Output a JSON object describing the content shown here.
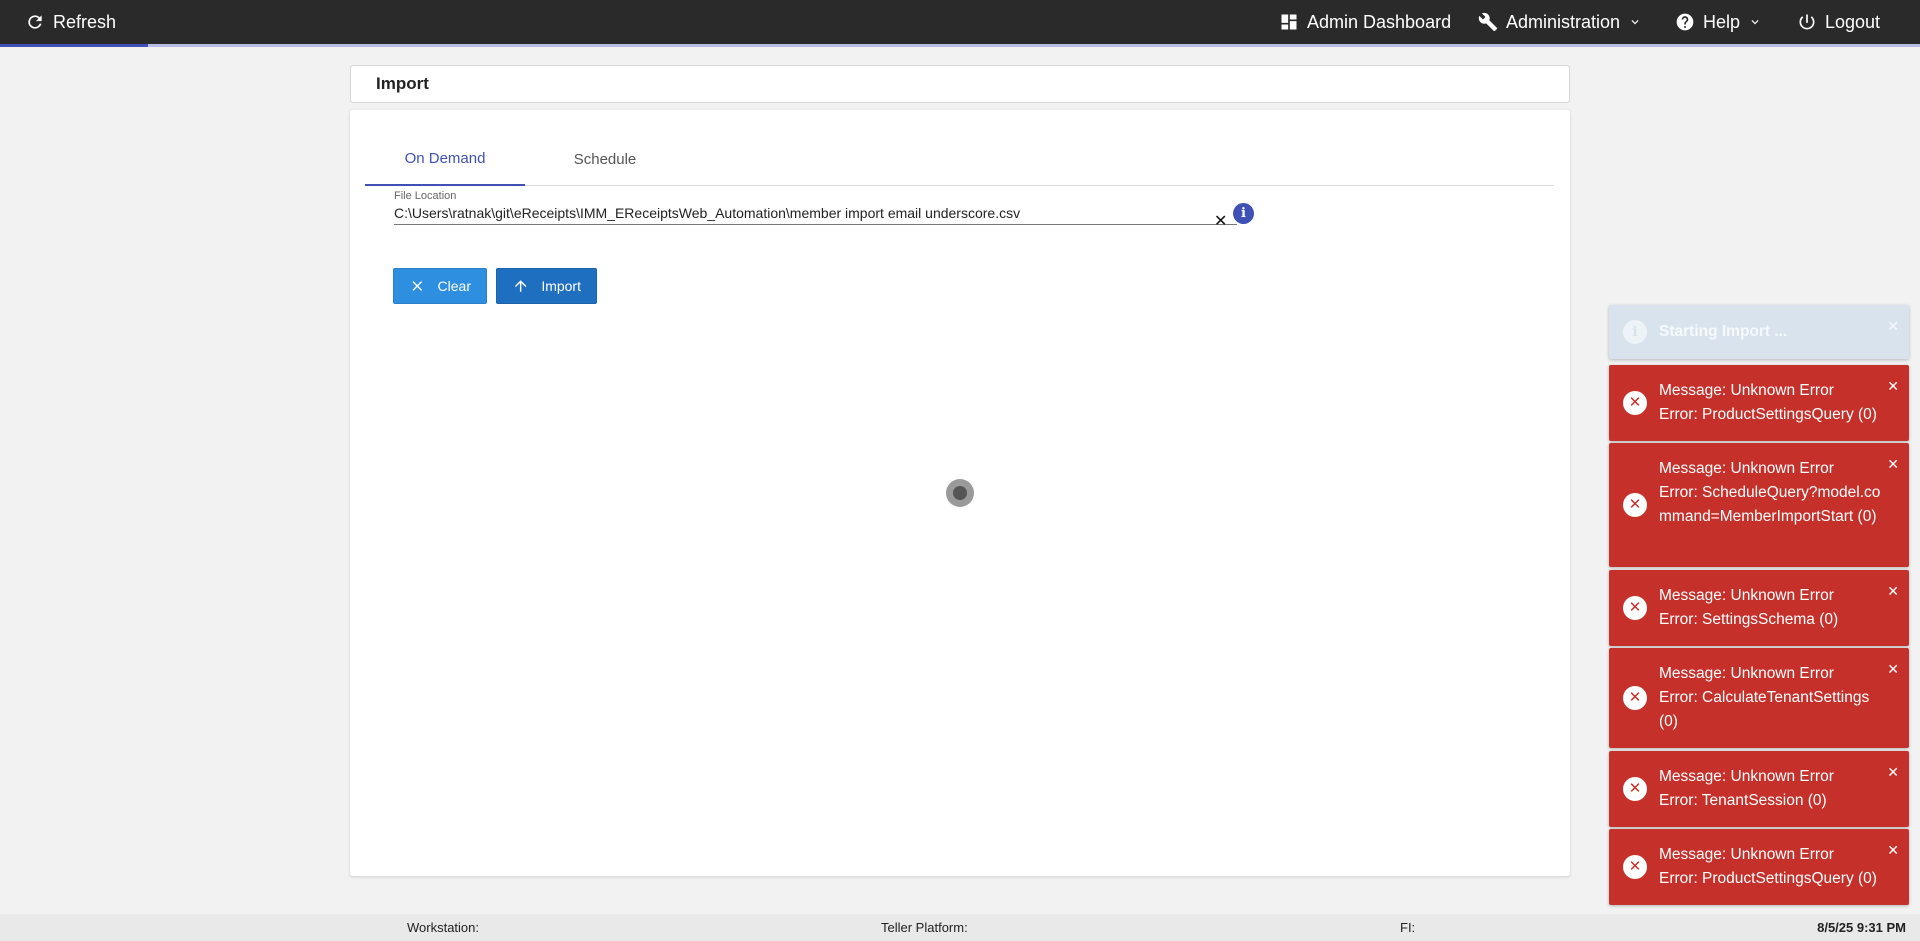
{
  "topbar": {
    "refresh_label": "Refresh",
    "admin_dashboard_label": "Admin Dashboard",
    "administration_label": "Administration",
    "help_label": "Help",
    "logout_label": "Logout",
    "progress_fraction": 0.077,
    "accent_color": "#3f51b5"
  },
  "page": {
    "title": "Import",
    "tabs": [
      {
        "label": "On Demand",
        "active": true
      },
      {
        "label": "Schedule",
        "active": false
      }
    ],
    "file_location": {
      "label": "File Location",
      "value": "C:\\Users\\ratnak\\git\\eReceipts\\IMM_EReceiptsWeb_Automation\\member import email underscore.csv",
      "clear_icon": "close-icon",
      "info_icon": "info-icon"
    },
    "buttons": {
      "clear_label": "Clear",
      "import_label": "Import"
    }
  },
  "toasts": [
    {
      "type": "info",
      "lines": [
        "Starting Import ..."
      ]
    },
    {
      "type": "error",
      "lines": [
        "Message: Unknown Error",
        "Error: ProductSettingsQuery (0)"
      ]
    },
    {
      "type": "error",
      "lines": [
        "Message: Unknown Error",
        "Error: ScheduleQuery?model.command=MemberImportStart (0)"
      ]
    },
    {
      "type": "error",
      "lines": [
        "Message: Unknown Error",
        "Error: SettingsSchema (0)"
      ]
    },
    {
      "type": "error",
      "lines": [
        "Message: Unknown Error",
        "Error: CalculateTenantSettings (0)"
      ]
    },
    {
      "type": "error",
      "lines": [
        "Message: Unknown Error",
        "Error: TenantSession (0)"
      ]
    },
    {
      "type": "error",
      "lines": [
        "Message: Unknown Error",
        "Error: ProductSettingsQuery (0)"
      ]
    }
  ],
  "footer": {
    "workstation_label": "Workstation:",
    "teller_platform_label": "Teller Platform:",
    "fi_label": "FI:",
    "datetime": "8/5/25 9:31 PM"
  },
  "colors": {
    "error": "#c5302b",
    "info": "#d9e3ee",
    "primary_button": "#1f6fc1",
    "secondary_button": "#2e8ee0"
  }
}
